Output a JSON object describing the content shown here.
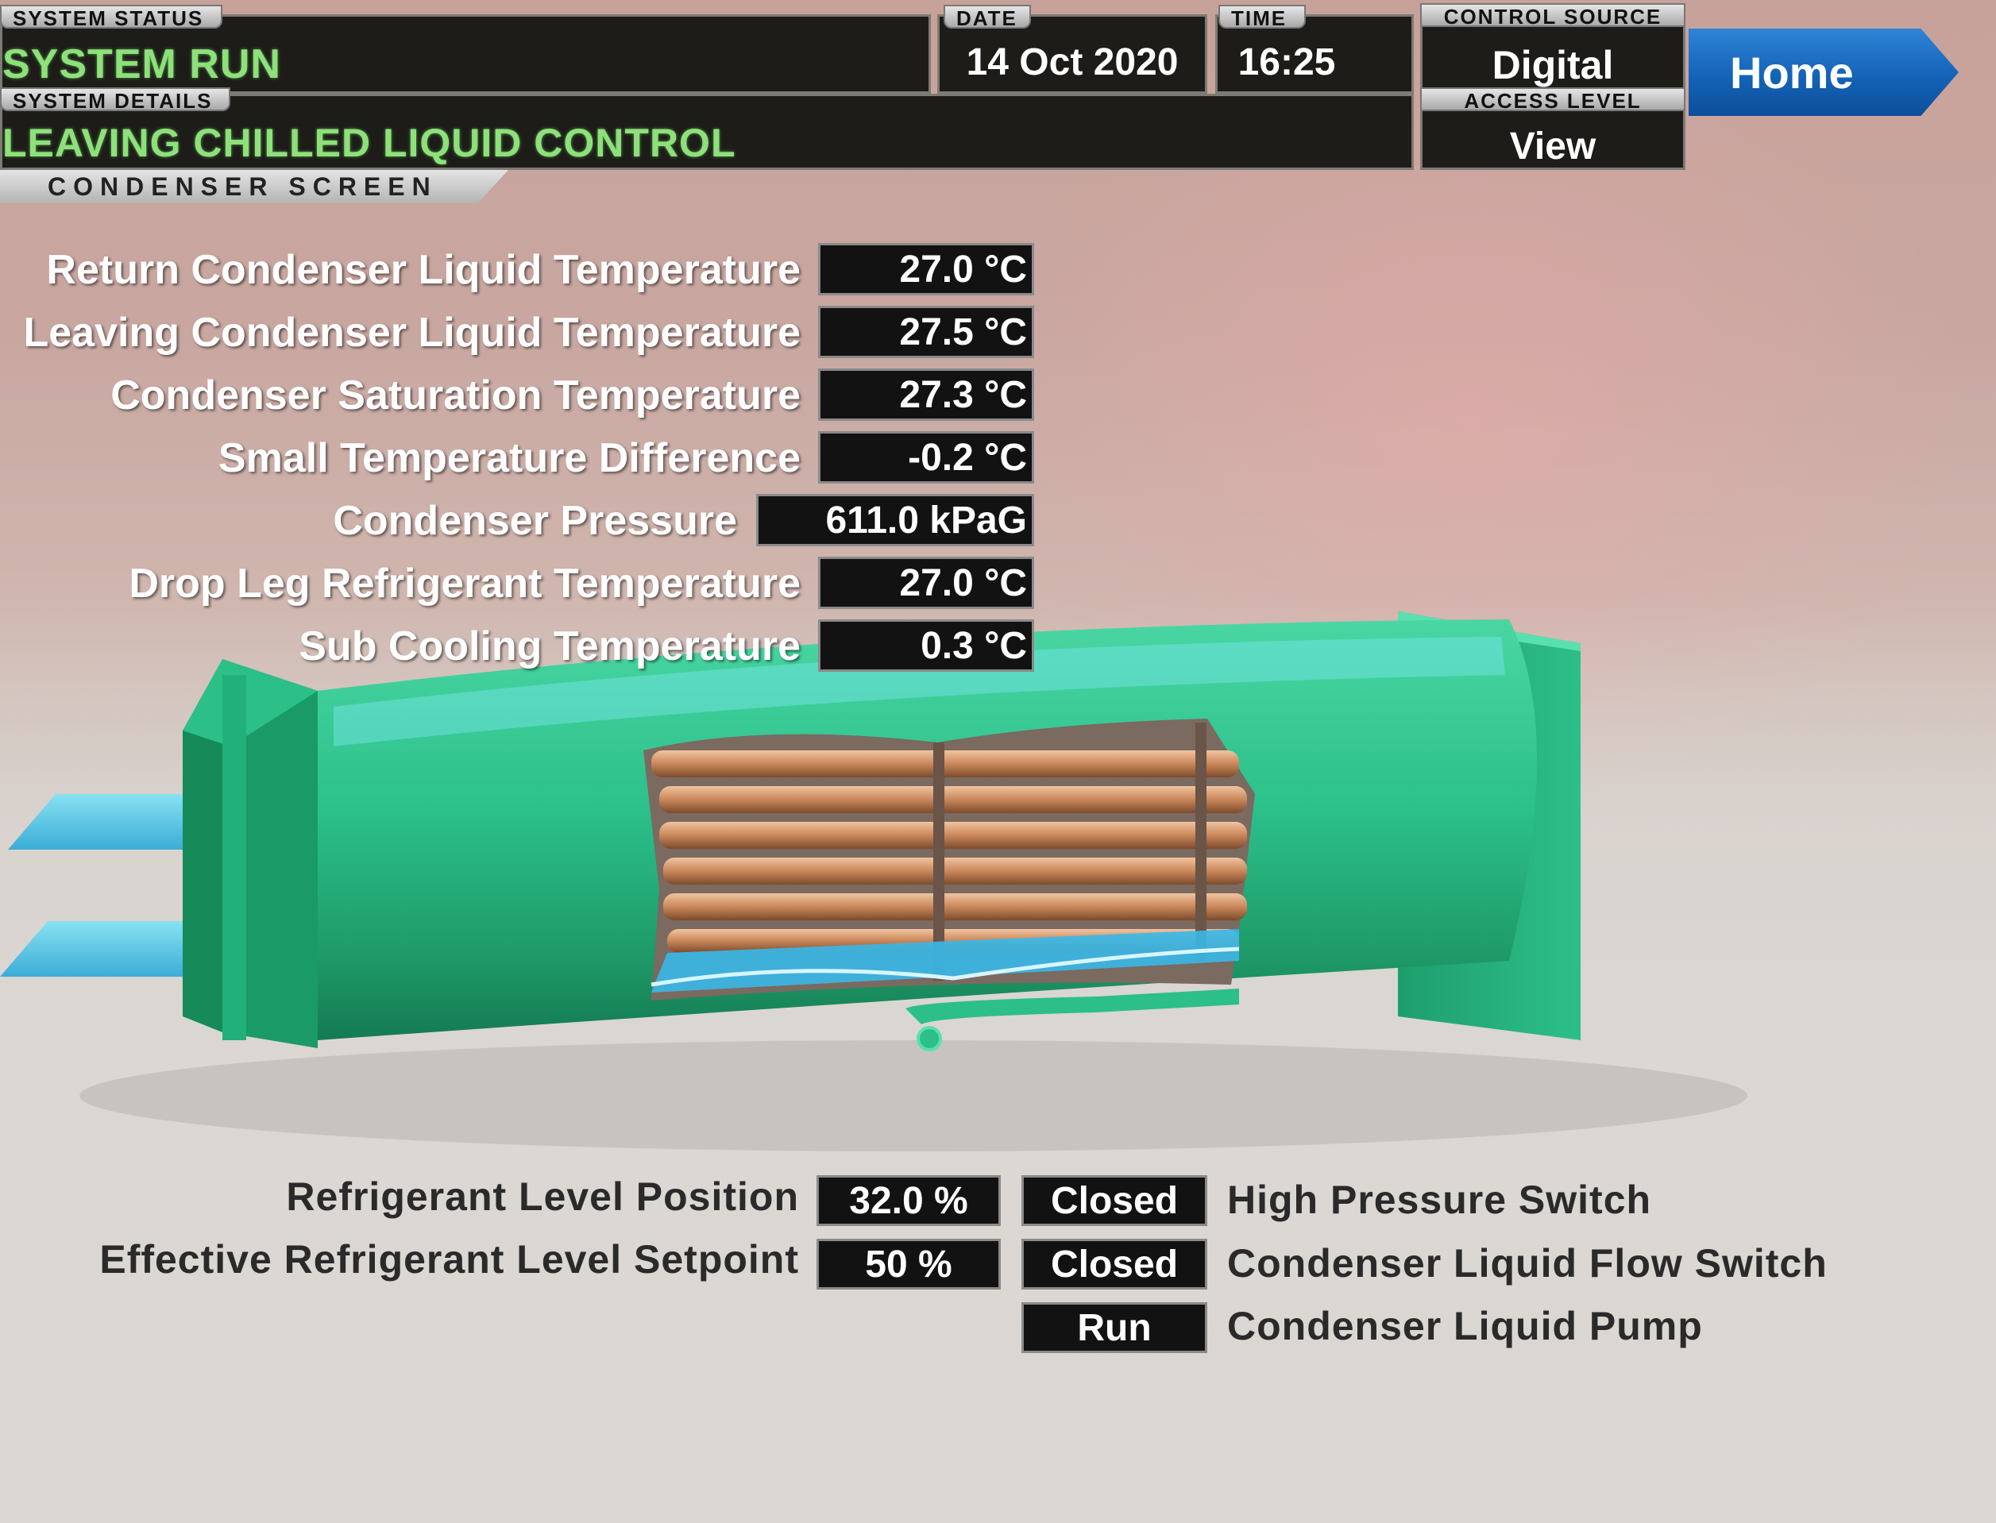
{
  "header": {
    "system_status_label": "SYSTEM STATUS",
    "system_status_value": "SYSTEM RUN",
    "system_details_label": "SYSTEM DETAILS",
    "system_details_value": "LEAVING CHILLED LIQUID CONTROL",
    "date_label": "DATE",
    "date_value": "14 Oct 2020",
    "time_label": "TIME",
    "time_value": "16:25",
    "control_source_label": "CONTROL SOURCE",
    "control_source_value": "Digital",
    "access_level_label": "ACCESS LEVEL",
    "access_level_value": "View",
    "home_label": "Home",
    "screen_title": "CONDENSER SCREEN"
  },
  "readings": [
    {
      "label": "Return Condenser Liquid Temperature",
      "value": "27.0 °C"
    },
    {
      "label": "Leaving Condenser Liquid Temperature",
      "value": "27.5 °C"
    },
    {
      "label": "Condenser Saturation Temperature",
      "value": "27.3 °C"
    },
    {
      "label": "Small Temperature Difference",
      "value": "-0.2 °C"
    },
    {
      "label": "Condenser Pressure",
      "value": "611.0 kPaG"
    },
    {
      "label": "Drop Leg Refrigerant Temperature",
      "value": "27.0 °C"
    },
    {
      "label": "Sub Cooling Temperature",
      "value": "0.3 °C"
    }
  ],
  "levels": [
    {
      "label": "Refrigerant Level Position",
      "value": "32.0 %"
    },
    {
      "label": "Effective Refrigerant Level Setpoint",
      "value": "50 %"
    }
  ],
  "switches": [
    {
      "state": "Closed",
      "label": "High Pressure Switch"
    },
    {
      "state": "Closed",
      "label": "Condenser Liquid Flow Switch"
    },
    {
      "state": "Run",
      "label": "Condenser Liquid Pump"
    }
  ],
  "colors": {
    "status_green": "#8de07a",
    "home_blue": "#1463b8",
    "vessel_green": "#2fbf86",
    "tube_copper": "#c98b5f",
    "liquid_blue": "#38b8e8"
  }
}
